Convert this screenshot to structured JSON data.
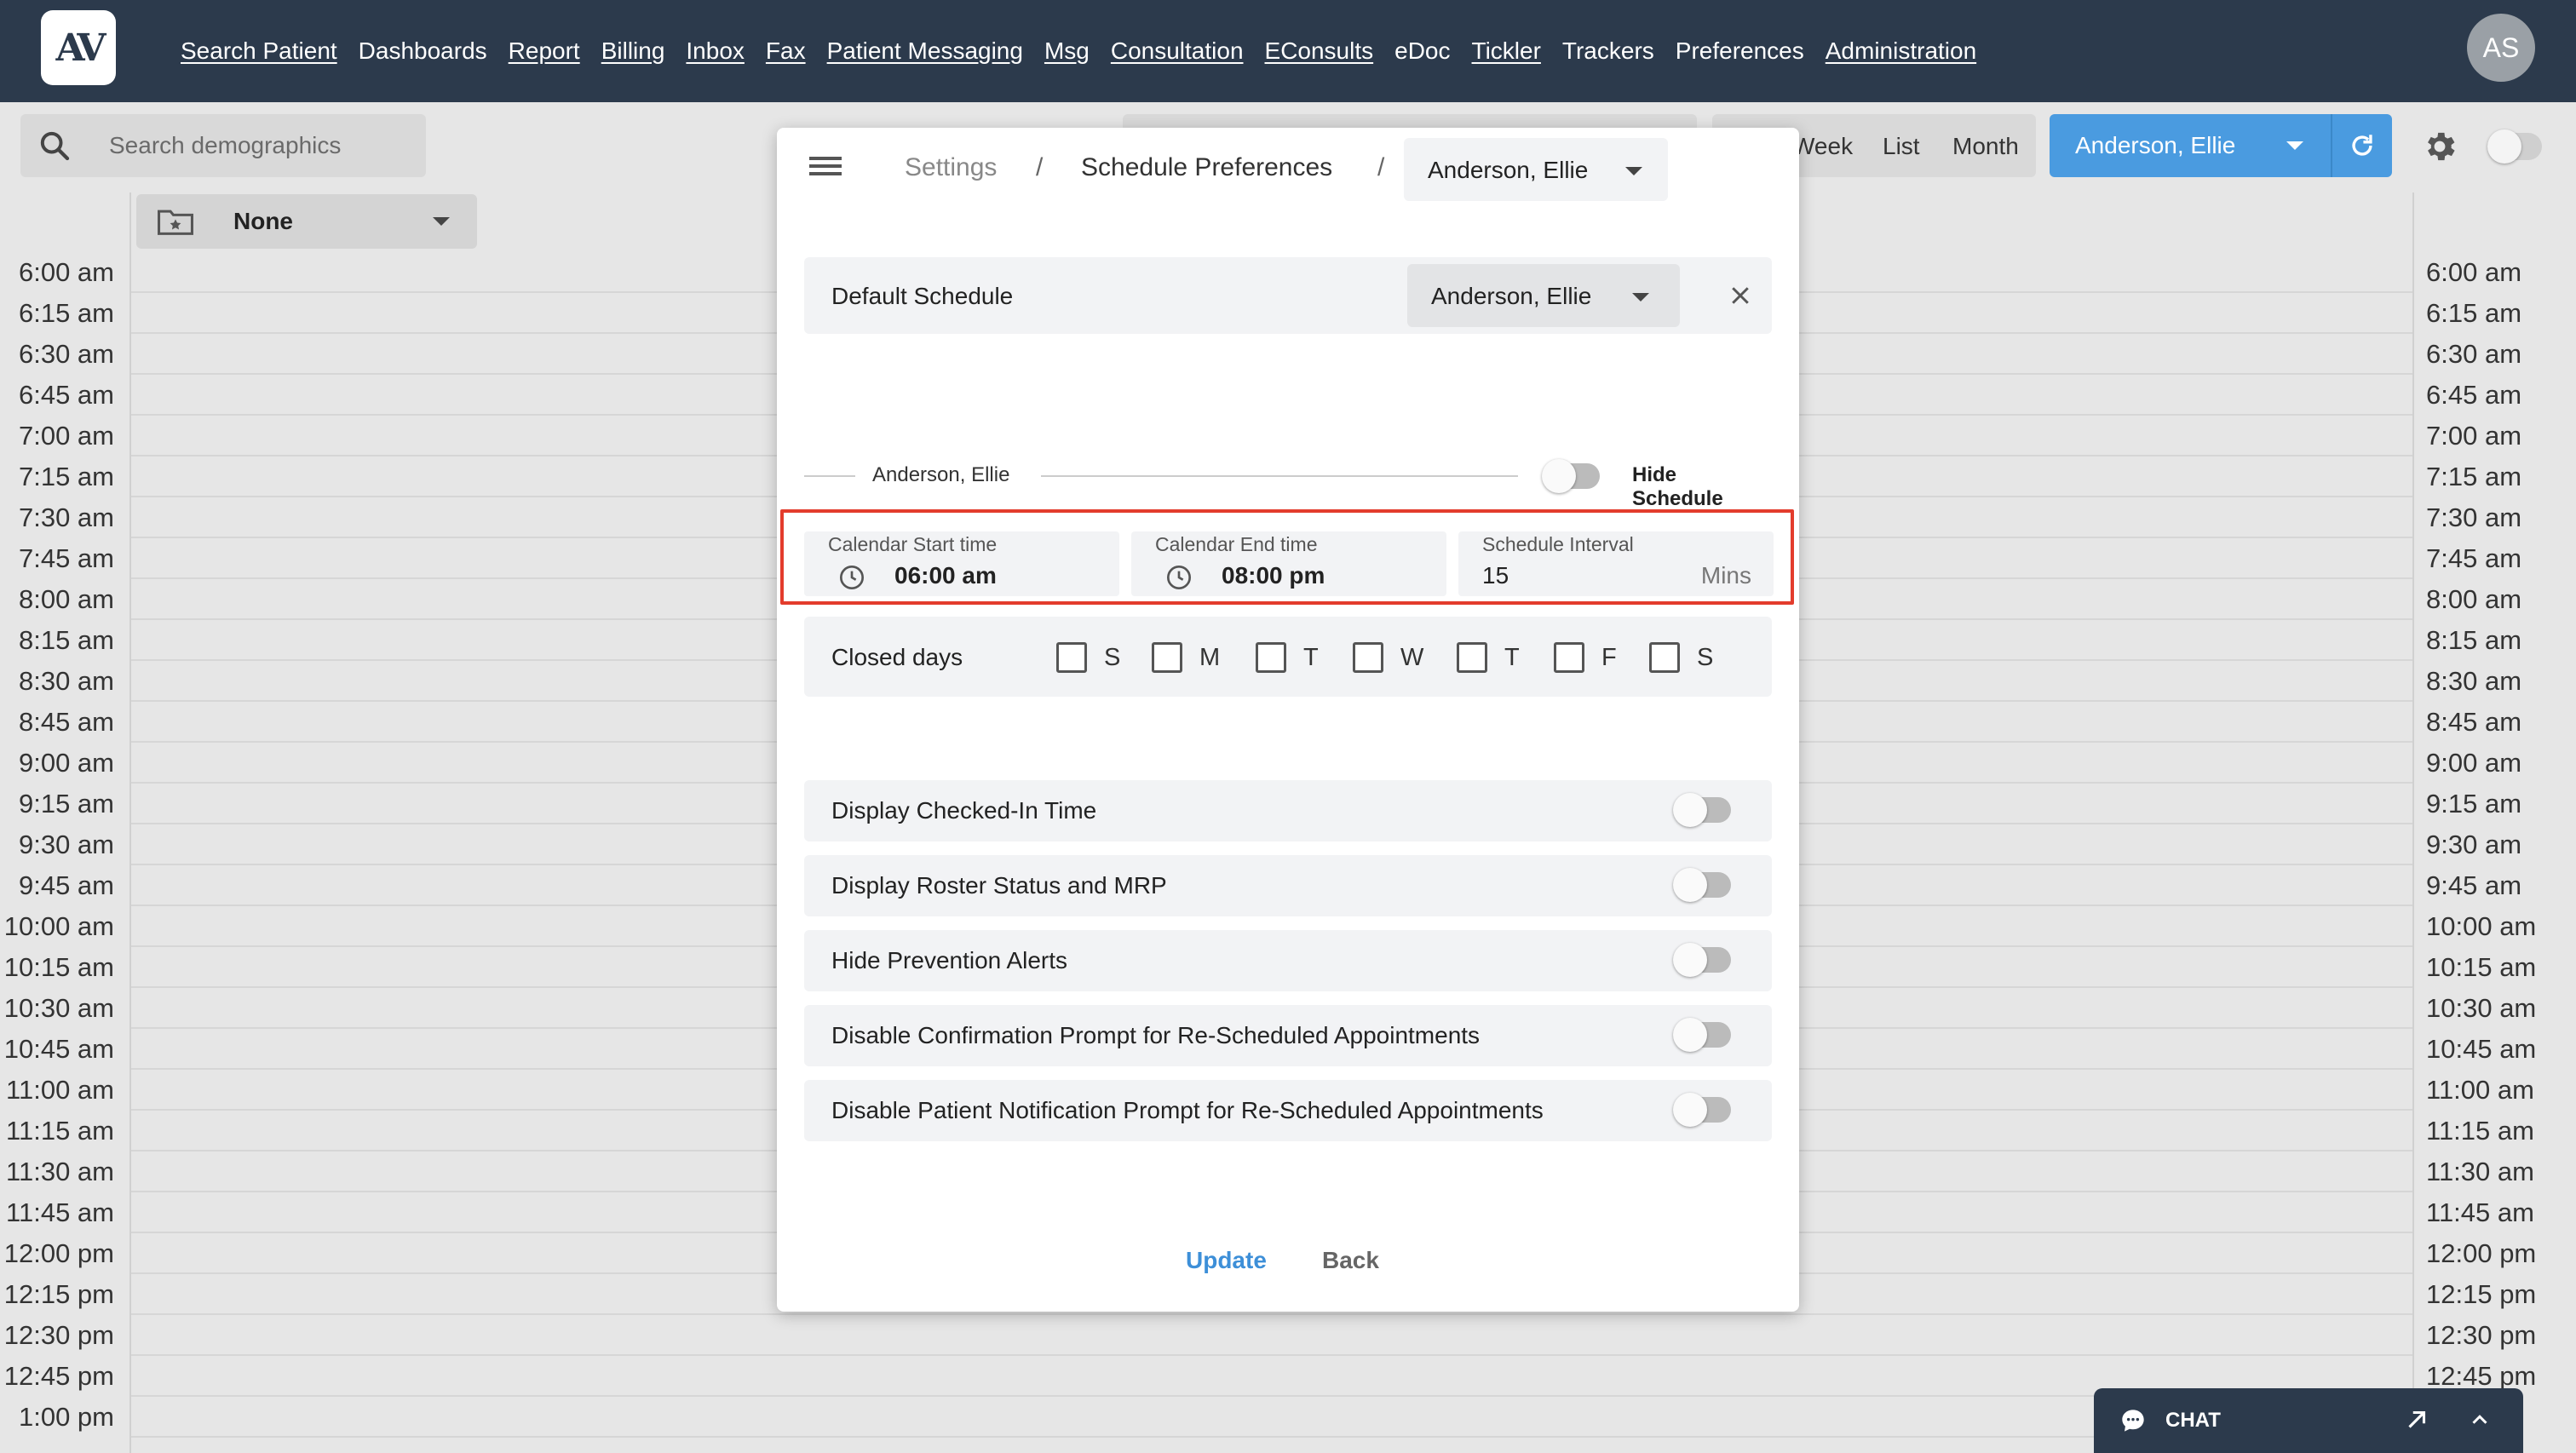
{
  "nav": {
    "logo": "AV",
    "items": [
      {
        "label": "Search Patient",
        "underline": true
      },
      {
        "label": "Dashboards",
        "underline": false
      },
      {
        "label": "Report",
        "underline": true
      },
      {
        "label": "Billing",
        "underline": true
      },
      {
        "label": "Inbox",
        "underline": true
      },
      {
        "label": "Fax",
        "underline": true
      },
      {
        "label": "Patient Messaging",
        "underline": true
      },
      {
        "label": "Msg",
        "underline": true
      },
      {
        "label": "Consultation",
        "underline": true
      },
      {
        "label": "EConsults",
        "underline": true
      },
      {
        "label": "eDoc",
        "underline": false
      },
      {
        "label": "Tickler",
        "underline": true
      },
      {
        "label": "Trackers",
        "underline": false
      },
      {
        "label": "Preferences",
        "underline": false
      },
      {
        "label": "Administration",
        "underline": true
      }
    ],
    "avatar": "AS"
  },
  "toolbar": {
    "search_placeholder": "Search demographics",
    "filter_value": "None",
    "views": [
      "Week",
      "List",
      "Month"
    ],
    "provider": "Anderson, Ellie"
  },
  "times": [
    "6:00 am",
    "6:15 am",
    "6:30 am",
    "6:45 am",
    "7:00 am",
    "7:15 am",
    "7:30 am",
    "7:45 am",
    "8:00 am",
    "8:15 am",
    "8:30 am",
    "8:45 am",
    "9:00 am",
    "9:15 am",
    "9:30 am",
    "9:45 am",
    "10:00 am",
    "10:15 am",
    "10:30 am",
    "10:45 am",
    "11:00 am",
    "11:15 am",
    "11:30 am",
    "11:45 am",
    "12:00 pm",
    "12:15 pm",
    "12:30 pm",
    "12:45 pm",
    "1:00 pm"
  ],
  "modal": {
    "breadcrumb": {
      "settings": "Settings",
      "separator": "/",
      "page": "Schedule Preferences",
      "provider": "Anderson, Ellie"
    },
    "default_schedule": {
      "label": "Default Schedule",
      "value": "Anderson, Ellie"
    },
    "schedule_section": {
      "name": "Anderson, Ellie",
      "hide_label": "Hide Schedule",
      "hidden": false
    },
    "calendar_start": {
      "caption": "Calendar Start time",
      "value": "06:00 am"
    },
    "calendar_end": {
      "caption": "Calendar End time",
      "value": "08:00 pm"
    },
    "interval": {
      "caption": "Schedule Interval",
      "value": "15",
      "unit": "Mins"
    },
    "closed_days": {
      "label": "Closed days",
      "days": [
        "S",
        "M",
        "T",
        "W",
        "T",
        "F",
        "S"
      ],
      "checked": [
        false,
        false,
        false,
        false,
        false,
        false,
        false
      ]
    },
    "toggles": [
      {
        "label": "Display Checked-In Time",
        "on": false
      },
      {
        "label": "Display Roster Status and MRP",
        "on": false
      },
      {
        "label": "Hide Prevention Alerts",
        "on": false
      },
      {
        "label": "Disable Confirmation Prompt for Re-Scheduled Appointments",
        "on": false
      },
      {
        "label": "Disable Patient Notification Prompt for Re-Scheduled Appointments",
        "on": false
      }
    ],
    "update_label": "Update",
    "back_label": "Back"
  },
  "chat": {
    "label": "CHAT"
  },
  "colors": {
    "nav": "#2c3a4c",
    "accent": "#4a9be0",
    "highlight": "#e33c2c"
  }
}
